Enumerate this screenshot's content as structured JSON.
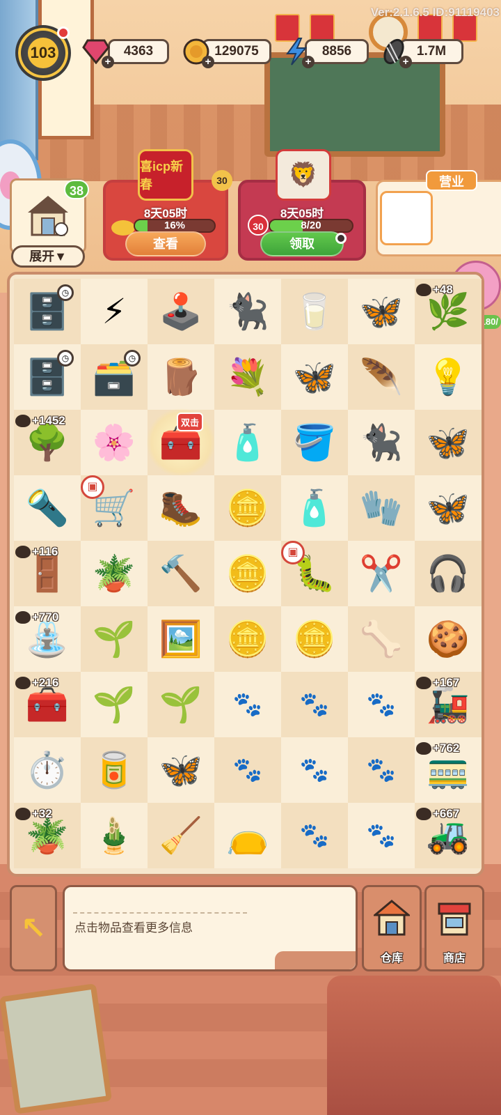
{
  "version_text": "Ver:2.1.6.5 ID:91119403",
  "player": {
    "level": "103"
  },
  "resources": [
    {
      "name": "gems",
      "value": "4363",
      "icon": "gem-icon",
      "color": "#e0466e"
    },
    {
      "name": "coins",
      "value": "129075",
      "icon": "coin-icon",
      "color": "#f3b63b"
    },
    {
      "name": "energy",
      "value": "8856",
      "icon": "lightning-icon",
      "color": "#3c8de0"
    },
    {
      "name": "seeds",
      "value": "1.7M",
      "icon": "sunflower-seed-icon",
      "color": "#4a4a4a"
    }
  ],
  "warehouse_card": {
    "badge": "38",
    "expand_label": "展开▼"
  },
  "events": [
    {
      "name": "spring-festival",
      "emblem_text": "喜icp新春",
      "timer": "8天05时",
      "progress_text": "16%",
      "progress": 0.16,
      "count": "30",
      "button": "查看"
    },
    {
      "name": "lion-dance",
      "timer": "8天05时",
      "progress_text": "8/20",
      "progress": 0.4,
      "count": "30",
      "button": "领取"
    }
  ],
  "business": {
    "tag": "营业"
  },
  "piggy": {
    "value": "180/"
  },
  "board": {
    "rows": [
      [
        {
          "icon": "🗄️",
          "name": "cabinet",
          "timer": true
        },
        {
          "icon": "⚡",
          "name": "energy-cabinet"
        },
        {
          "icon": "🕹️",
          "name": "arcade-machine"
        },
        {
          "icon": "🐈‍⬛",
          "name": "cat-food-bag"
        },
        {
          "icon": "🥛",
          "name": "milk-pack"
        },
        {
          "icon": "🦋",
          "name": "energy-moth"
        },
        {
          "icon": "🌿",
          "name": "energy-plant",
          "tag": "+48"
        }
      ],
      [
        {
          "icon": "🗄️",
          "name": "cabinet-2",
          "timer": true
        },
        {
          "icon": "🗃️",
          "name": "drawer",
          "timer": true
        },
        {
          "icon": "🪵",
          "name": "wood-planks"
        },
        {
          "icon": "💐",
          "name": "flower-pot"
        },
        {
          "icon": "🦋",
          "name": "butterfly"
        },
        {
          "icon": "🪶",
          "name": "moth"
        },
        {
          "icon": "💡",
          "name": "chandelier"
        }
      ],
      [
        {
          "icon": "🌳",
          "name": "energy-tree",
          "tag": "+1452"
        },
        {
          "icon": "🌸",
          "name": "flower-plant"
        },
        {
          "icon": "🧰",
          "name": "treasure-chest",
          "double": "双击",
          "glow": true
        },
        {
          "icon": "🧴",
          "name": "spray-bottle"
        },
        {
          "icon": "🪣",
          "name": "bucket"
        },
        {
          "icon": "🐈‍⬛",
          "name": "sleeping-cat"
        },
        {
          "icon": "🦋",
          "name": "moth-2"
        }
      ],
      [
        {
          "icon": "🔦",
          "name": "spotlight"
        },
        {
          "icon": "🛒",
          "name": "cart",
          "gift": true
        },
        {
          "icon": "🥾",
          "name": "rain-boots"
        },
        {
          "icon": "🪙",
          "name": "coin-pile"
        },
        {
          "icon": "🧴",
          "name": "bottle"
        },
        {
          "icon": "🧤",
          "name": "gloves"
        },
        {
          "icon": "🦋",
          "name": "orange-butterfly"
        }
      ],
      [
        {
          "icon": "🚪",
          "name": "energy-cabinet-3",
          "tag": "+116"
        },
        {
          "icon": "🪴",
          "name": "soil-box"
        },
        {
          "icon": "🔨",
          "name": "hammer"
        },
        {
          "icon": "🪙",
          "name": "coin-stack"
        },
        {
          "icon": "🐛",
          "name": "cocoon",
          "gift": true
        },
        {
          "icon": "✂️",
          "name": "pliers"
        },
        {
          "icon": "🎧",
          "name": "headphones"
        }
      ],
      [
        {
          "icon": "⛲",
          "name": "energy-fountain",
          "tag": "+770"
        },
        {
          "icon": "🌱",
          "name": "sprout-box"
        },
        {
          "icon": "🖼️",
          "name": "photos"
        },
        {
          "icon": "🪙",
          "name": "coin"
        },
        {
          "icon": "🪙",
          "name": "coins-2"
        },
        {
          "icon": "🦴",
          "name": "handle"
        },
        {
          "icon": "🍪",
          "name": "biscuit"
        }
      ],
      [
        {
          "icon": "🧰",
          "name": "energy-toolbox",
          "tag": "+216"
        },
        {
          "icon": "🌱",
          "name": "seed-box"
        },
        {
          "icon": "🌱",
          "name": "seedling"
        },
        {
          "icon": "",
          "name": "empty"
        },
        {
          "icon": "",
          "name": "empty"
        },
        {
          "icon": "",
          "name": "empty"
        },
        {
          "icon": "🚂",
          "name": "energy-cart",
          "tag": "+167"
        }
      ],
      [
        {
          "icon": "⏱️",
          "name": "pocket-watch"
        },
        {
          "icon": "🥫",
          "name": "paint-can"
        },
        {
          "icon": "🦋",
          "name": "yellow-butterfly"
        },
        {
          "icon": "",
          "name": "empty"
        },
        {
          "icon": "",
          "name": "empty"
        },
        {
          "icon": "",
          "name": "empty"
        },
        {
          "icon": "🚃",
          "name": "energy-train",
          "tag": "+762"
        }
      ],
      [
        {
          "icon": "🪴",
          "name": "energy-pot",
          "tag": "+32"
        },
        {
          "icon": "🎍",
          "name": "bonsai"
        },
        {
          "icon": "🧹",
          "name": "feather-duster"
        },
        {
          "icon": "👝",
          "name": "pouch"
        },
        {
          "icon": "",
          "name": "empty"
        },
        {
          "icon": "",
          "name": "empty"
        },
        {
          "icon": "🚜",
          "name": "energy-machine",
          "tag": "+667"
        }
      ]
    ]
  },
  "info": {
    "text": "点击物品查看更多信息"
  },
  "buttons": {
    "warehouse": "仓库",
    "shop": "商店"
  }
}
